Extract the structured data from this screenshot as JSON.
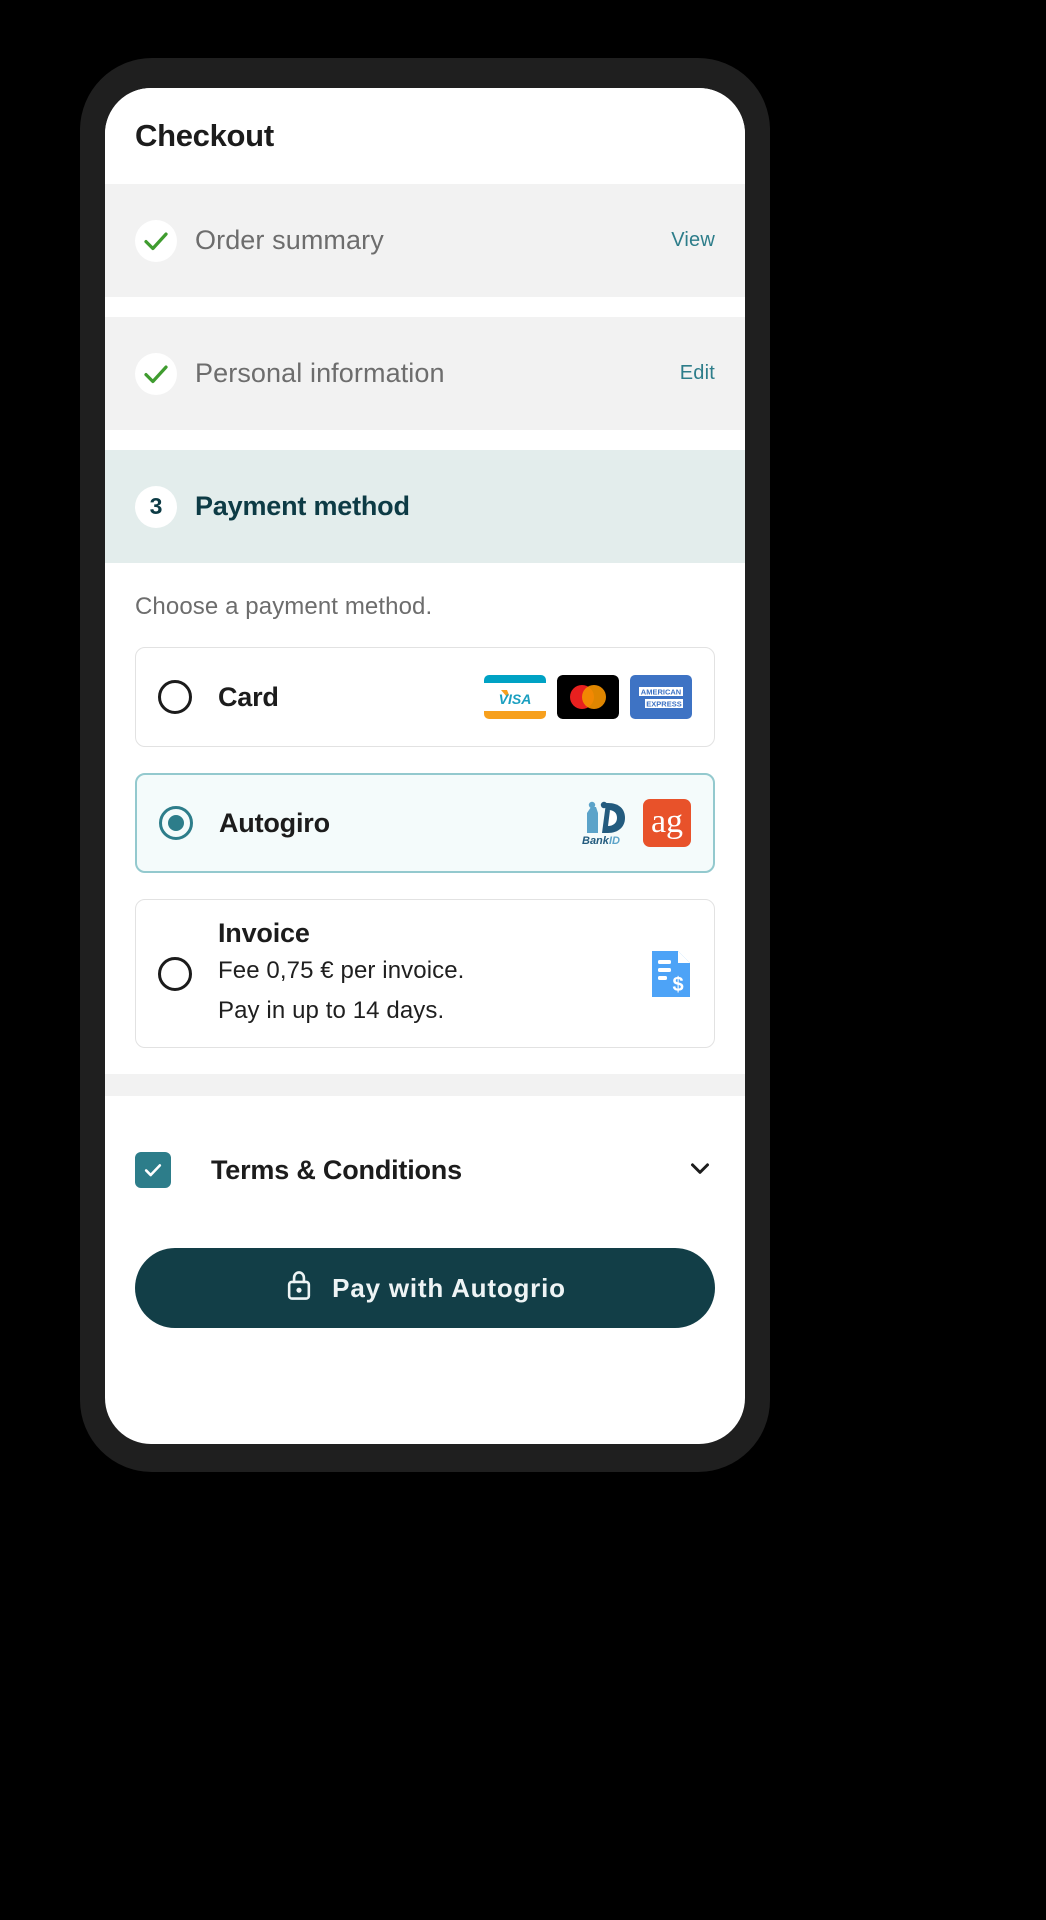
{
  "header": {
    "title": "Checkout"
  },
  "steps": [
    {
      "id": "order-summary",
      "label": "Order summary",
      "action": "View",
      "state": "complete",
      "icon": "check-icon"
    },
    {
      "id": "personal-information",
      "label": "Personal information",
      "action": "Edit",
      "state": "complete",
      "icon": "check-icon"
    },
    {
      "id": "payment-method",
      "number": "3",
      "label": "Payment method",
      "state": "active"
    }
  ],
  "payment": {
    "prompt": "Choose a payment method.",
    "options": [
      {
        "id": "card",
        "title": "Card",
        "selected": false,
        "logos": [
          "visa-logo",
          "mastercard-logo",
          "amex-logo"
        ],
        "visa_text": "VISA",
        "amex_line1": "AMERICAN",
        "amex_line2": "EXPRESS"
      },
      {
        "id": "autogiro",
        "title": "Autogiro",
        "selected": true,
        "logos": [
          "bankid-logo",
          "autogiro-ag-logo"
        ],
        "bankid_text_1": "Bank",
        "bankid_text_2": "ID",
        "ag_text": "ag"
      },
      {
        "id": "invoice",
        "title": "Invoice",
        "selected": false,
        "sub_line_1": "Fee 0,75 € per invoice.",
        "sub_line_2": "Pay in up to 14 days.",
        "logos": [
          "invoice-document-icon"
        ]
      }
    ]
  },
  "terms": {
    "label": "Terms & Conditions",
    "checked": true,
    "expand_icon": "chevron-down-icon"
  },
  "cta": {
    "label": "Pay with Autogrio",
    "icon": "lock-icon"
  },
  "colors": {
    "accent_teal": "#2d7d8a",
    "dark_teal": "#123e47",
    "active_step_bg": "#e3edec",
    "row_bg": "#f2f2f2",
    "check_green": "#3f9c2f",
    "selected_border": "#93c9ce",
    "selected_bg": "#f4fbfb",
    "ag_orange": "#e8522a",
    "invoice_blue": "#4da3f7"
  }
}
